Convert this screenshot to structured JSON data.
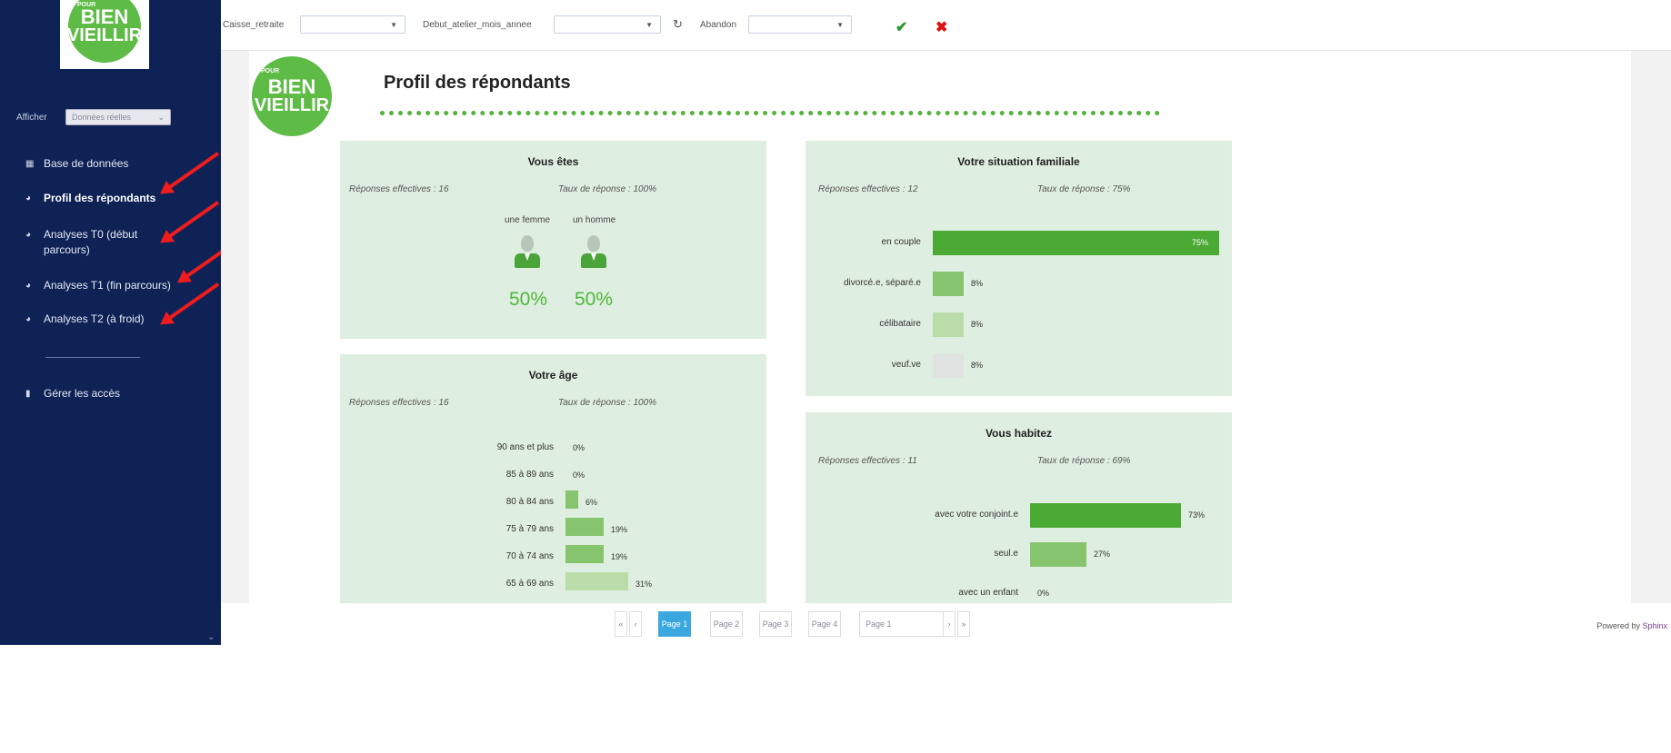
{
  "sidebar": {
    "logo": {
      "line1": "BIEN",
      "line2": "VIEILLIR",
      "small": "POUR"
    },
    "show_label": "Afficher",
    "show_value": "Données réelles",
    "items": [
      {
        "icon": "grid-icon",
        "label": "Base de données"
      },
      {
        "icon": "bar-chart-icon",
        "label": "Profil des répondants"
      },
      {
        "icon": "bar-chart-icon",
        "label": "Analyses T0 (début",
        "label2": "parcours)"
      },
      {
        "icon": "bar-chart-icon",
        "label": "Analyses T1 (fin parcours)"
      },
      {
        "icon": "bar-chart-icon",
        "label": "Analyses T2 (à froid)"
      },
      {
        "icon": "bookmark-icon",
        "label": "Gérer les accès"
      }
    ],
    "annotation_color": "#ee1c1c"
  },
  "filters": {
    "caisse_label": "Caisse_retraite",
    "debut_label": "Debut_atelier_mois_annee",
    "abandon_label": "Abandon"
  },
  "page": {
    "title": "Profil des répondants",
    "logo": {
      "line1": "BIEN",
      "line2": "VIEILLIR",
      "small": "POUR"
    }
  },
  "cards": {
    "vous_etes": {
      "title": "Vous êtes",
      "responses": "Réponses effectives : 16",
      "rate": "Taux de réponse : 100%",
      "female_label": "une femme",
      "male_label": "un homme",
      "female_pct": "50%",
      "male_pct": "50%"
    },
    "situation": {
      "title": "Votre situation familiale",
      "responses": "Réponses effectives : 12",
      "rate": "Taux de réponse : 75%",
      "rows": [
        {
          "label": "en couple",
          "value": 75,
          "text": "75%"
        },
        {
          "label": "divorcé.e, séparé.e",
          "value": 8,
          "text": "8%"
        },
        {
          "label": "célibataire",
          "value": 8,
          "text": "8%"
        },
        {
          "label": "veuf.ve",
          "value": 8,
          "text": "8%"
        }
      ]
    },
    "age": {
      "title": "Votre âge",
      "responses": "Réponses effectives : 16",
      "rate": "Taux de réponse : 100%",
      "rows": [
        {
          "label": "90 ans et plus",
          "value": 0,
          "text": "0%"
        },
        {
          "label": "85 à 89 ans",
          "value": 0,
          "text": "0%"
        },
        {
          "label": "80 à 84 ans",
          "value": 6,
          "text": "6%"
        },
        {
          "label": "75 à 79 ans",
          "value": 19,
          "text": "19%"
        },
        {
          "label": "70 à 74 ans",
          "value": 19,
          "text": "19%"
        },
        {
          "label": "65 à 69 ans",
          "value": 31,
          "text": "31%"
        }
      ]
    },
    "habitez": {
      "title": "Vous habitez",
      "responses": "Réponses effectives : 11",
      "rate": "Taux de réponse : 69%",
      "rows": [
        {
          "label": "avec votre conjoint.e",
          "value": 73,
          "text": "73%"
        },
        {
          "label": "seul.e",
          "value": 27,
          "text": "27%"
        },
        {
          "label": "avec un enfant",
          "value": 0,
          "text": "0%"
        }
      ]
    }
  },
  "pagination": {
    "first": "«",
    "prev": "‹",
    "pages": [
      "Page 1",
      "Page 2",
      "Page 3",
      "Page 4"
    ],
    "selected": "Page 1",
    "next": "›",
    "last": "»"
  },
  "footer": {
    "powered_prefix": "Powered by",
    "powered_brand": "Sphinx"
  },
  "colors": {
    "sidebar_bg": "#0e2256",
    "card_bg": "#deeee0",
    "bar_dark": "#4aaa33",
    "bar_mid": "#86c46e",
    "bar_light": "#b9dca9",
    "bar_grey": "#e0e3e1",
    "accent_green": "#4fb83a",
    "page_active": "#3aa8de"
  }
}
